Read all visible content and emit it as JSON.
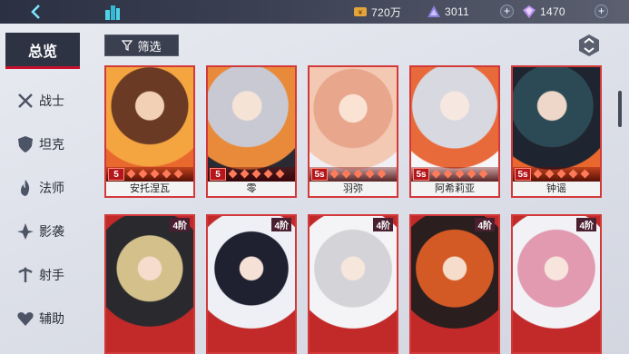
{
  "topbar": {
    "gold": "720万",
    "energy": "3011",
    "gems": "1470",
    "plus": "+"
  },
  "sidebar": {
    "all_label": "总览",
    "items": [
      {
        "label": "战士",
        "icon": "swords-icon"
      },
      {
        "label": "坦克",
        "icon": "shield-icon"
      },
      {
        "label": "法师",
        "icon": "flame-icon"
      },
      {
        "label": "影袭",
        "icon": "shadow-icon"
      },
      {
        "label": "射手",
        "icon": "arrow-icon"
      },
      {
        "label": "辅助",
        "icon": "heart-icon"
      }
    ]
  },
  "filter_label": "筛选",
  "row1": [
    {
      "name": "安托涅瓦",
      "rank": "5",
      "color": "#6b3a24"
    },
    {
      "name": "零",
      "rank": "5",
      "color": "#c9c9d3"
    },
    {
      "name": "羽弥",
      "rank": "5s",
      "color": "#e8a68c"
    },
    {
      "name": "阿希莉亚",
      "rank": "5s",
      "color": "#d8d8e0"
    },
    {
      "name": "钟谣",
      "rank": "5s",
      "color": "#2c4a55"
    }
  ],
  "row2": [
    {
      "rank": "4",
      "badge": "4阶",
      "color": "#d3c08a"
    },
    {
      "rank": "4",
      "badge": "4阶",
      "color": "#1f2030"
    },
    {
      "rank": "4",
      "badge": "4阶",
      "color": "#d4d4d8"
    },
    {
      "rank": "4",
      "badge": "4阶",
      "color": "#d45a25"
    },
    {
      "rank": "4",
      "badge": "4阶",
      "color": "#e29ab0"
    }
  ]
}
